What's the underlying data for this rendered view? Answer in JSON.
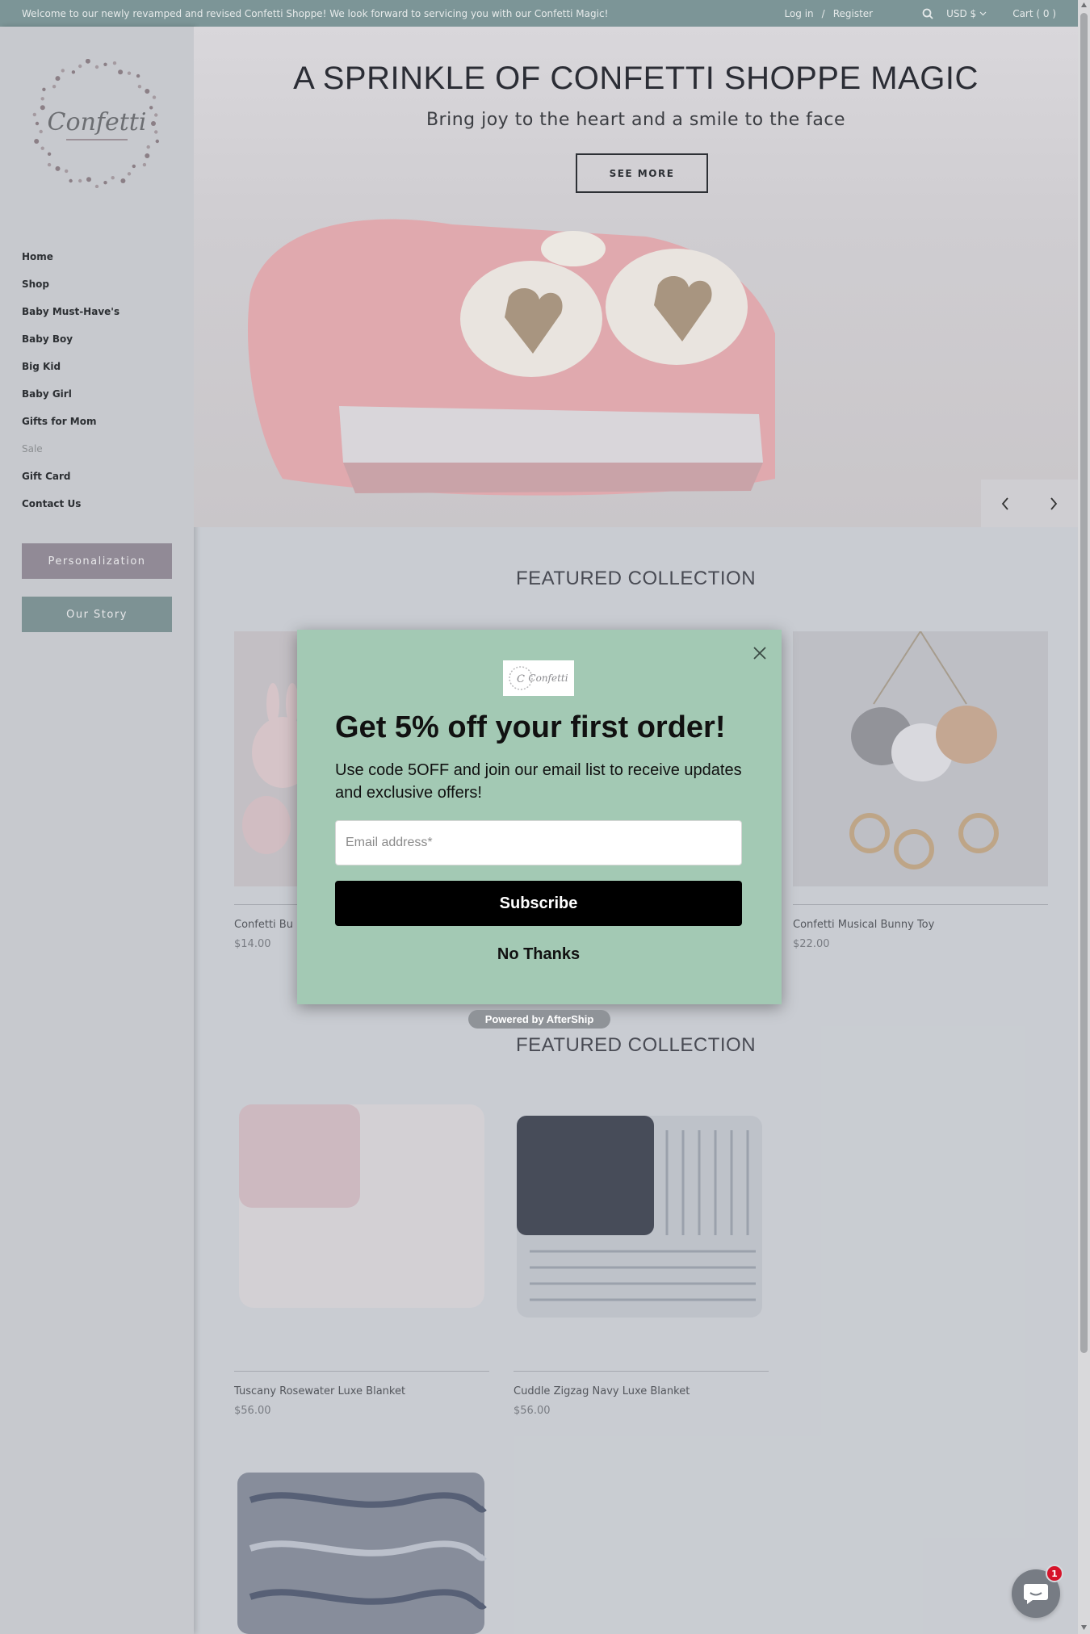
{
  "announcement": {
    "message": "Welcome to our newly revamped and revised Confetti Shoppe! We look forward to servicing you with our Confetti Magic!",
    "login": "Log in",
    "separator": "/",
    "register": "Register",
    "currency": "USD $",
    "cart": "Cart ( 0 )"
  },
  "sidebar": {
    "logo_text": "Confetti",
    "nav": [
      {
        "label": "Home"
      },
      {
        "label": "Shop"
      },
      {
        "label": "Baby Must-Have's"
      },
      {
        "label": "Baby Boy"
      },
      {
        "label": "Big Kid"
      },
      {
        "label": "Baby Girl"
      },
      {
        "label": "Gifts for Mom"
      },
      {
        "label": "Sale"
      },
      {
        "label": "Gift Card"
      },
      {
        "label": "Contact Us"
      }
    ],
    "personalization_label": "Personalization",
    "our_story_label": "Our Story"
  },
  "hero": {
    "title": "A SPRINKLE OF CONFETTI SHOPPE MAGIC",
    "subtitle": "Bring joy to the heart and a smile to the face",
    "button": "SEE MORE"
  },
  "featured1": {
    "title": "FEATURED COLLECTION",
    "products": [
      {
        "name": "Confetti Bu",
        "price": "$14.00"
      },
      {
        "name": "Confetti Musical Bunny Toy",
        "price": "$22.00"
      }
    ]
  },
  "featured2": {
    "title": "FEATURED COLLECTION",
    "products": [
      {
        "name": "Tuscany Rosewater Luxe Blanket",
        "price": "$56.00"
      },
      {
        "name": "Cuddle Zigzag Navy Luxe Blanket",
        "price": "$56.00"
      }
    ]
  },
  "popup": {
    "headline": "Get 5% off your first order!",
    "description": "Use code 5OFF and join our email list to receive updates and exclusive offers!",
    "email_placeholder": "Email address*",
    "subscribe": "Subscribe",
    "no_thanks": "No Thanks",
    "powered_by": "Powered by AfterShip"
  },
  "chat": {
    "badge": "1"
  }
}
